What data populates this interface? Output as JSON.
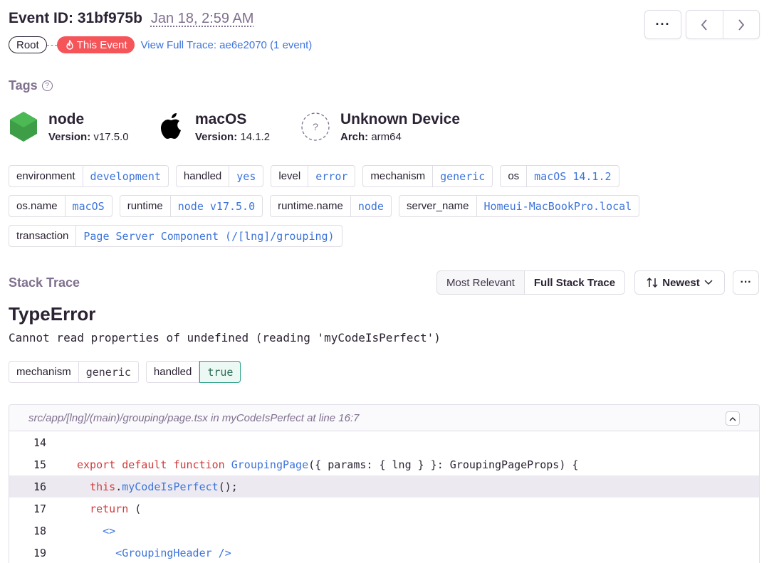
{
  "header": {
    "event_id": "Event ID: 31bf975b",
    "date": "Jan 18, 2:59 AM",
    "more_label": "···",
    "prev_icon": "chevron-left",
    "next_icon": "chevron-right"
  },
  "trace": {
    "root_label": "Root",
    "this_event_label": "This Event",
    "full_trace_link": "View Full Trace: ae6e2070 (1 event)"
  },
  "tags": {
    "title": "Tags",
    "contexts": [
      {
        "name": "node",
        "sub_key": "Version:",
        "sub_val": "v17.5.0",
        "icon": "nodejs-icon",
        "color": "#3d9e47"
      },
      {
        "name": "macOS",
        "sub_key": "Version:",
        "sub_val": "14.1.2",
        "icon": "apple-icon",
        "color": "#000000"
      },
      {
        "name": "Unknown Device",
        "sub_key": "Arch:",
        "sub_val": "arm64",
        "icon": "unknown-device-icon",
        "color": "#80708f"
      }
    ],
    "rows": [
      [
        {
          "key": "environment",
          "value": "development"
        },
        {
          "key": "handled",
          "value": "yes"
        },
        {
          "key": "level",
          "value": "error"
        },
        {
          "key": "mechanism",
          "value": "generic"
        },
        {
          "key": "os",
          "value": "macOS 14.1.2"
        }
      ],
      [
        {
          "key": "os.name",
          "value": "macOS"
        },
        {
          "key": "runtime",
          "value": "node v17.5.0"
        },
        {
          "key": "runtime.name",
          "value": "node"
        },
        {
          "key": "server_name",
          "value": "Homeui-MacBookPro.local"
        }
      ],
      [
        {
          "key": "transaction",
          "value": "Page Server Component (/[lng]/grouping)"
        }
      ]
    ]
  },
  "stack": {
    "title": "Stack Trace",
    "seg_most_relevant": "Most Relevant",
    "seg_full": "Full Stack Trace",
    "sort_label": "Newest",
    "more_label": "···",
    "error_type": "TypeError",
    "error_message": "Cannot read properties of undefined (reading 'myCodeIsPerfect')",
    "mechanism_key": "mechanism",
    "mechanism_val": "generic",
    "handled_key": "handled",
    "handled_val": "true",
    "frame": {
      "file": "src/app/[lng]/(main)/grouping/page.tsx",
      "in_label": "in",
      "function": "myCodeIsPerfect",
      "at_label": "at line",
      "line": "16:7",
      "highlight_line": 16
    },
    "code": [
      {
        "n": "14",
        "parts": []
      },
      {
        "n": "15",
        "parts": [
          {
            "t": "export default function ",
            "c": "kw"
          },
          {
            "t": "GroupingPage",
            "c": "fnc"
          },
          {
            "t": "({ params: { lng } }: GroupingPageProps) {",
            "c": "tx"
          }
        ]
      },
      {
        "n": "16",
        "parts": [
          {
            "t": "  ",
            "c": "tx"
          },
          {
            "t": "this",
            "c": "kw"
          },
          {
            "t": ".",
            "c": "tx"
          },
          {
            "t": "myCodeIsPerfect",
            "c": "fnc"
          },
          {
            "t": "();",
            "c": "tx"
          }
        ]
      },
      {
        "n": "17",
        "parts": [
          {
            "t": "  ",
            "c": "tx"
          },
          {
            "t": "return",
            "c": "kw"
          },
          {
            "t": " (",
            "c": "tx"
          }
        ]
      },
      {
        "n": "18",
        "parts": [
          {
            "t": "    <>",
            "c": "fnc"
          }
        ]
      },
      {
        "n": "19",
        "parts": [
          {
            "t": "      <GroupingHeader />",
            "c": "fnc"
          }
        ]
      }
    ]
  }
}
